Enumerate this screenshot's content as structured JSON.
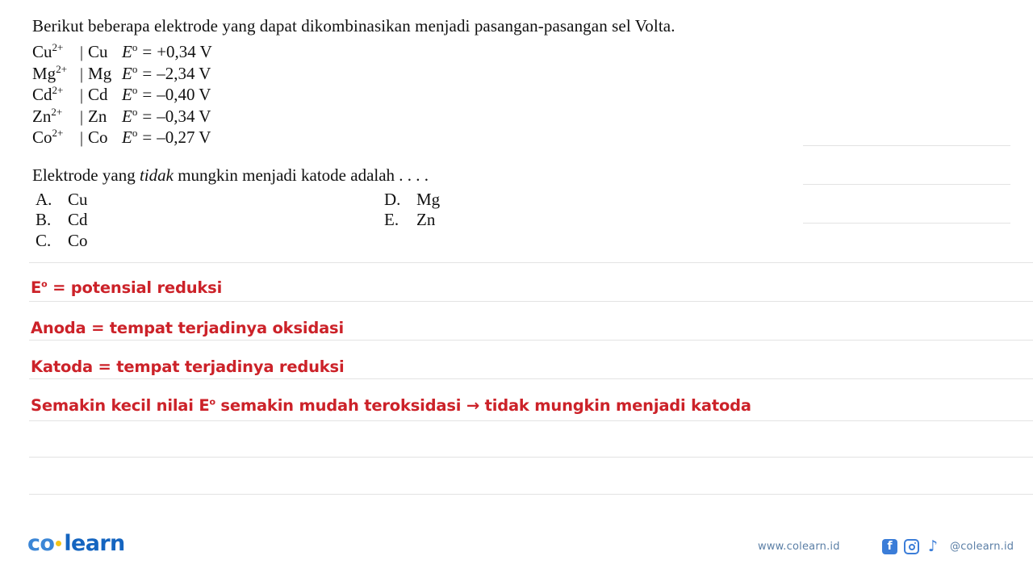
{
  "question": {
    "intro": "Berikut beberapa elektrode yang dapat dikombinasikan menjadi pasangan-pasangan sel Volta.",
    "electrodes": [
      {
        "ion": "Cu",
        "charge": "2+",
        "separator": "|",
        "metal": "Cu",
        "symbol": "E",
        "degree": "o",
        "equals": "=",
        "value": "+0,34 V"
      },
      {
        "ion": "Mg",
        "charge": "2+",
        "separator": "|",
        "metal": "Mg",
        "symbol": "E",
        "degree": "o",
        "equals": "=",
        "value": "–2,34 V"
      },
      {
        "ion": "Cd",
        "charge": "2+",
        "separator": "|",
        "metal": "Cd",
        "symbol": "E",
        "degree": "o",
        "equals": "=",
        "value": "–0,40 V"
      },
      {
        "ion": "Zn",
        "charge": "2+",
        "separator": "|",
        "metal": "Zn",
        "symbol": "E",
        "degree": "o",
        "equals": "=",
        "value": "–0,34 V"
      },
      {
        "ion": "Co",
        "charge": "2+",
        "separator": "|",
        "metal": "Co",
        "symbol": "E",
        "degree": "o",
        "equals": "=",
        "value": "–0,27 V"
      }
    ],
    "prompt_before": "Elektrode yang ",
    "prompt_italic": "tidak",
    "prompt_after": " mungkin menjadi katode adalah . . . .",
    "options_left": [
      {
        "label": "A.",
        "text": "Cu"
      },
      {
        "label": "B.",
        "text": "Cd"
      },
      {
        "label": "C.",
        "text": "Co"
      }
    ],
    "options_right": [
      {
        "label": "D.",
        "text": "Mg"
      },
      {
        "label": "E.",
        "text": "Zn"
      }
    ]
  },
  "annotations": {
    "color": "#cc2229",
    "line1_before": "E",
    "line1_degree": "o",
    "line1_after": " = potensial reduksi",
    "line2": "Anoda = tempat terjadinya oksidasi",
    "line3": "Katoda = tempat terjadinya reduksi",
    "line4_before": "Semakin kecil nilai E",
    "line4_degree": "o",
    "line4_after": " semakin mudah teroksidasi → tidak mungkin menjadi katoda"
  },
  "footer": {
    "logo_co": "co",
    "logo_dot": "dot-separator",
    "logo_learn": "learn",
    "website": "www.colearn.id",
    "handle": "@colearn.id",
    "facebook_glyph": "f",
    "tiktok_glyph": "♪",
    "brand_blue": "#1565c0",
    "accent_yellow": "#f5c518"
  }
}
